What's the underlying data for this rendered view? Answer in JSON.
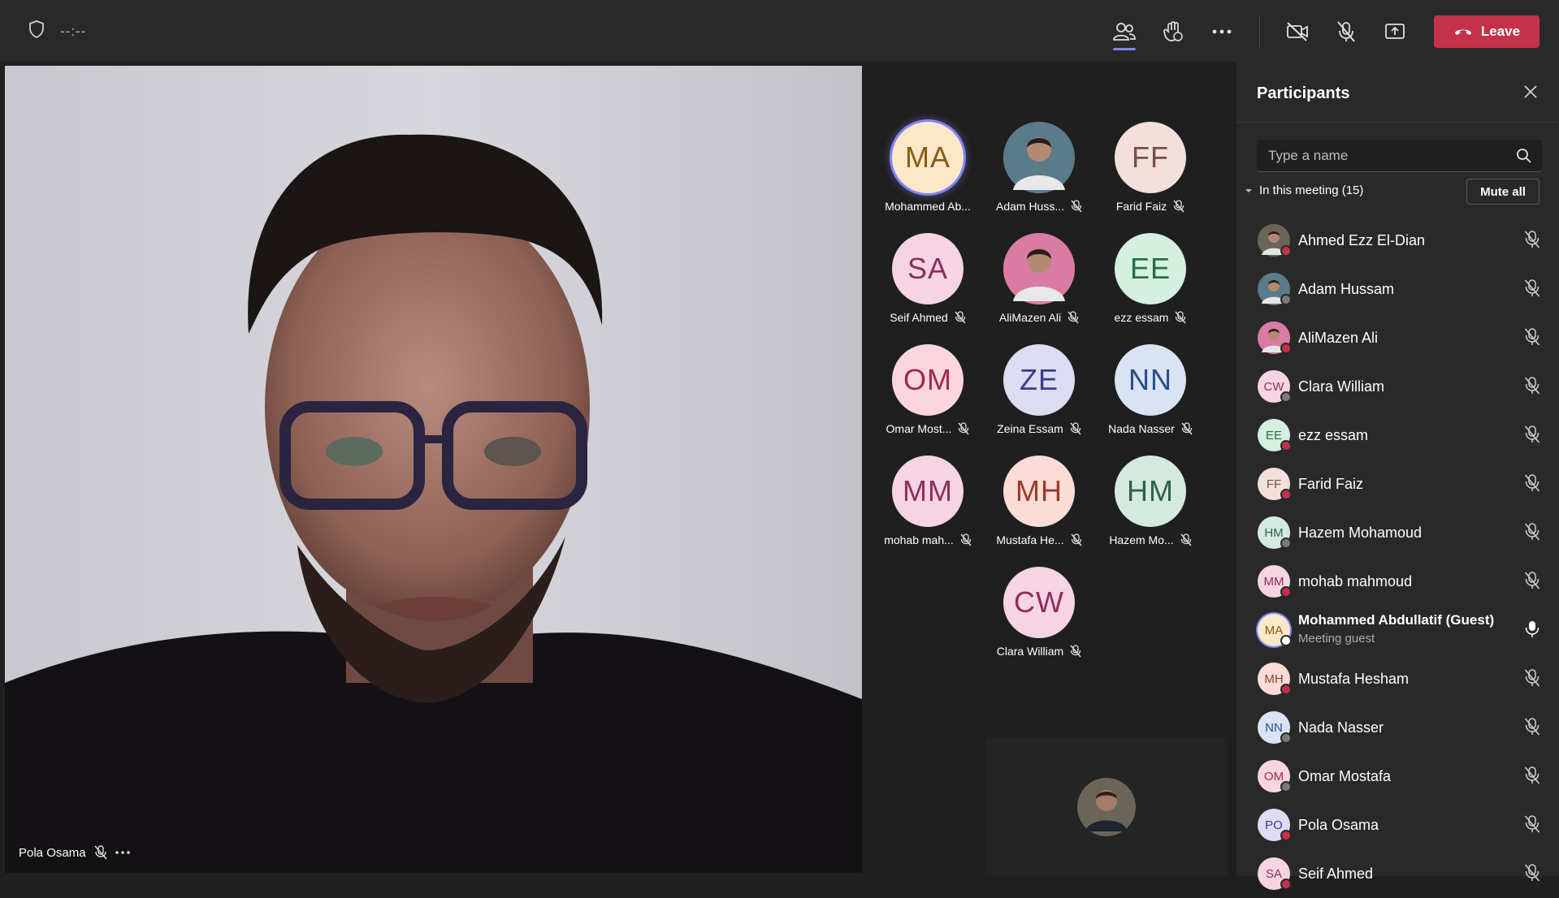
{
  "topbar": {
    "timer": "--:--",
    "icons": [
      "shield-icon",
      "people-icon",
      "raise-hand-icon",
      "more-icon",
      "camera-off-icon",
      "mic-off-icon",
      "share-screen-icon"
    ],
    "leave_label": "Leave"
  },
  "stage": {
    "speaker_name": "Pola Osama"
  },
  "grid": {
    "tiles": [
      {
        "initials": "MA",
        "name": "Mohammed Ab...",
        "bg": "#fbe8c8",
        "fg": "#8a5a13",
        "photo": false,
        "muted": false,
        "active": true
      },
      {
        "initials": "",
        "name": "Adam Huss...",
        "bg": "#5b7a8a",
        "fg": "#ffffff",
        "photo": true,
        "muted": true,
        "active": false
      },
      {
        "initials": "FF",
        "name": "Farid Faiz",
        "bg": "#f3e0dc",
        "fg": "#7a4d46",
        "photo": false,
        "muted": true,
        "active": false
      },
      {
        "initials": "SA",
        "name": "Seif Ahmed",
        "bg": "#f6d4e4",
        "fg": "#8e2f5a",
        "photo": false,
        "muted": true,
        "active": false
      },
      {
        "initials": "",
        "name": "AliMazen Ali",
        "bg": "#d97ba3",
        "fg": "#ffffff",
        "photo": true,
        "muted": true,
        "active": false
      },
      {
        "initials": "EE",
        "name": "ezz essam",
        "bg": "#d5efe0",
        "fg": "#276e44",
        "photo": false,
        "muted": true,
        "active": false
      },
      {
        "initials": "OM",
        "name": "Omar Most...",
        "bg": "#f9d6dd",
        "fg": "#a12a44",
        "photo": false,
        "muted": true,
        "active": false
      },
      {
        "initials": "ZE",
        "name": "Zeina Essam",
        "bg": "#dcdcf3",
        "fg": "#3b3d8a",
        "photo": false,
        "muted": true,
        "active": false
      },
      {
        "initials": "NN",
        "name": "Nada Nasser",
        "bg": "#d9e3f3",
        "fg": "#264e8a",
        "photo": false,
        "muted": true,
        "active": false
      },
      {
        "initials": "MM",
        "name": "mohab mah...",
        "bg": "#f6d4e4",
        "fg": "#8e2f5a",
        "photo": false,
        "muted": true,
        "active": false
      },
      {
        "initials": "MH",
        "name": "Mustafa He...",
        "bg": "#fbdcd6",
        "fg": "#9a3b2b",
        "photo": false,
        "muted": true,
        "active": false
      },
      {
        "initials": "HM",
        "name": "Hazem Mo...",
        "bg": "#d5eadf",
        "fg": "#2d6149",
        "photo": false,
        "muted": true,
        "active": false
      },
      {
        "initials": "CW",
        "name": "Clara William",
        "bg": "#f6d4e4",
        "fg": "#8e2f5a",
        "photo": false,
        "muted": true,
        "active": false
      }
    ]
  },
  "panel": {
    "title": "Participants",
    "search_placeholder": "Type a name",
    "section_label": "In this meeting (15)",
    "mute_all_label": "Mute all",
    "participants": [
      {
        "name": "Ahmed Ezz El-Dian",
        "initials": "",
        "bg": "#6b6458",
        "fg": "#fff",
        "status": "#c4314b",
        "photo": true,
        "mic": "off"
      },
      {
        "name": "Adam Hussam",
        "initials": "",
        "bg": "#5b7a8a",
        "fg": "#fff",
        "status": "#7a7a7a",
        "photo": true,
        "mic": "off"
      },
      {
        "name": "AliMazen Ali",
        "initials": "",
        "bg": "#d97ba3",
        "fg": "#fff",
        "status": "#c4314b",
        "photo": true,
        "mic": "off"
      },
      {
        "name": "Clara William",
        "initials": "CW",
        "bg": "#f6d4e4",
        "fg": "#8e2f5a",
        "status": "#7a7a7a",
        "photo": false,
        "mic": "off"
      },
      {
        "name": "ezz essam",
        "initials": "EE",
        "bg": "#d5efe0",
        "fg": "#276e44",
        "status": "#c4314b",
        "photo": false,
        "mic": "off"
      },
      {
        "name": "Farid Faiz",
        "initials": "FF",
        "bg": "#f3e0dc",
        "fg": "#7a4d46",
        "status": "#c4314b",
        "photo": false,
        "mic": "off"
      },
      {
        "name": "Hazem Mohamoud",
        "initials": "HM",
        "bg": "#d5eadf",
        "fg": "#2d6149",
        "status": "#7a7a7a",
        "photo": false,
        "mic": "off"
      },
      {
        "name": "mohab mahmoud",
        "initials": "MM",
        "bg": "#f6d4e4",
        "fg": "#8e2f5a",
        "status": "#c4314b",
        "photo": false,
        "mic": "off"
      },
      {
        "name": "Mohammed Abdullatif (Guest)",
        "sub": "Meeting guest",
        "initials": "MA",
        "bg": "#fbe8c8",
        "fg": "#8a5a13",
        "status": "#ffffff",
        "photo": false,
        "mic": "on",
        "bold": true
      },
      {
        "name": "Mustafa Hesham",
        "initials": "MH",
        "bg": "#fbdcd6",
        "fg": "#9a3b2b",
        "status": "#c4314b",
        "photo": false,
        "mic": "off"
      },
      {
        "name": "Nada Nasser",
        "initials": "NN",
        "bg": "#d9e3f3",
        "fg": "#264e8a",
        "status": "#7a7a7a",
        "photo": false,
        "mic": "off"
      },
      {
        "name": "Omar Mostafa",
        "initials": "OM",
        "bg": "#f9d6dd",
        "fg": "#a12a44",
        "status": "#7a7a7a",
        "photo": false,
        "mic": "off"
      },
      {
        "name": "Pola Osama",
        "initials": "PO",
        "bg": "#dcdcf3",
        "fg": "#3b3d8a",
        "status": "#c4314b",
        "photo": false,
        "mic": "off"
      },
      {
        "name": "Seif Ahmed",
        "initials": "SA",
        "bg": "#f6d4e4",
        "fg": "#8e2f5a",
        "status": "#c4314b",
        "photo": false,
        "mic": "off"
      }
    ]
  }
}
